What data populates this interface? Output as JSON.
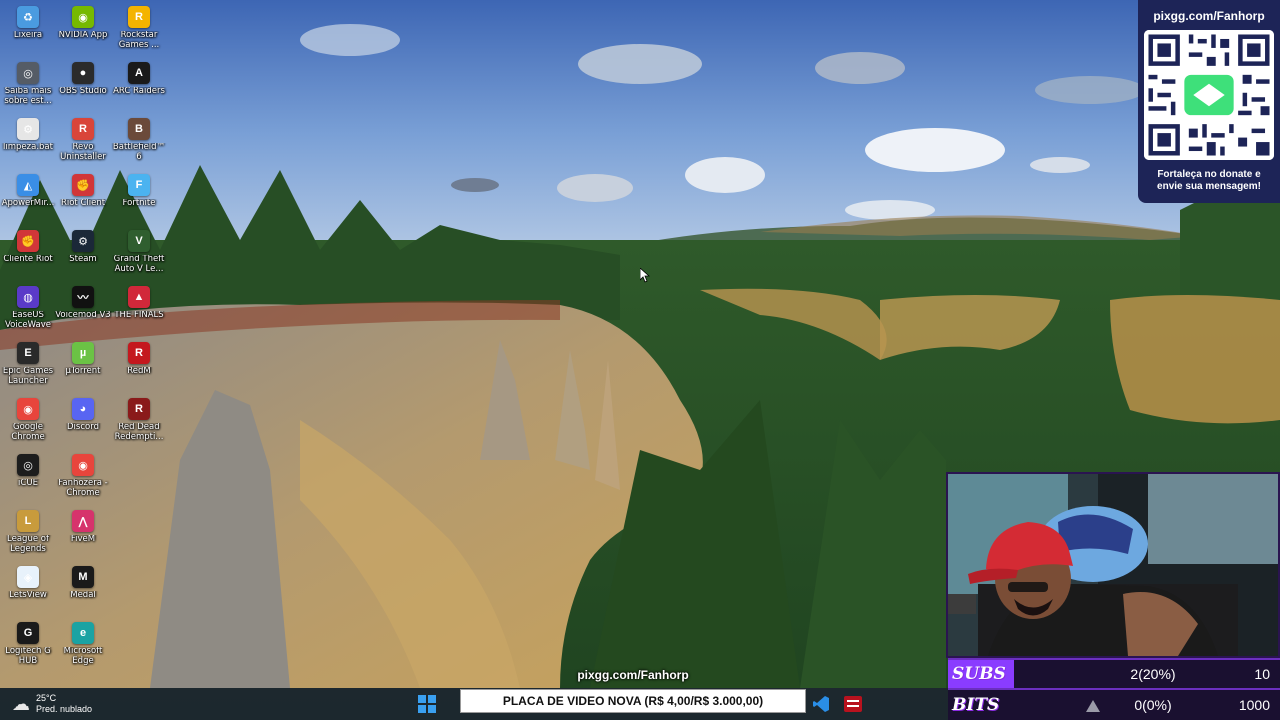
{
  "desktop_icons": [
    {
      "label": "Lixeira",
      "icon": "recycle-bin-icon",
      "color": "#4a9be0",
      "glyph": "♻"
    },
    {
      "label": "NVIDIA App",
      "icon": "nvidia-icon",
      "color": "#76b900",
      "glyph": "◉"
    },
    {
      "label": "Rockstar Games ...",
      "icon": "rockstar-icon",
      "color": "#f4b400",
      "glyph": "R"
    },
    {
      "label": "Saiba mais sobre est...",
      "icon": "info-camera-icon",
      "color": "#555c66",
      "glyph": "◎"
    },
    {
      "label": "OBS Studio",
      "icon": "obs-icon",
      "color": "#2b2b2b",
      "glyph": "●"
    },
    {
      "label": "ARC Raiders",
      "icon": "arc-raiders-icon",
      "color": "#1a1a1a",
      "glyph": "A"
    },
    {
      "label": "limpeza.bat",
      "icon": "bat-file-icon",
      "color": "#e6e6e6",
      "glyph": "⚙"
    },
    {
      "label": "Revo Uninstaller",
      "icon": "revo-icon",
      "color": "#d9453a",
      "glyph": "R"
    },
    {
      "label": "Battlefield™ 6",
      "icon": "battlefield-icon",
      "color": "#6b4a3a",
      "glyph": "B"
    },
    {
      "label": "ApowerMir...",
      "icon": "apowermirror-icon",
      "color": "#3a8ee6",
      "glyph": "◭"
    },
    {
      "label": "Riot Client",
      "icon": "riot-icon",
      "color": "#d13639",
      "glyph": "✊"
    },
    {
      "label": "Fortnite",
      "icon": "fortnite-icon",
      "color": "#4bb3f0",
      "glyph": "F"
    },
    {
      "label": "Cliente Riot",
      "icon": "riot-client-icon",
      "color": "#d13639",
      "glyph": "✊"
    },
    {
      "label": "Steam",
      "icon": "steam-icon",
      "color": "#1b2838",
      "glyph": "⚙"
    },
    {
      "label": "Grand Theft Auto V Le...",
      "icon": "gta-icon",
      "color": "#2f5e2f",
      "glyph": "V"
    },
    {
      "label": "EaseUS VoiceWave",
      "icon": "voicewave-icon",
      "color": "#5a3ac8",
      "glyph": "◍"
    },
    {
      "label": "Voicemod V3",
      "icon": "voicemod-icon",
      "color": "#111111",
      "glyph": "〰"
    },
    {
      "label": "THE FINALS",
      "icon": "the-finals-icon",
      "color": "#d1283a",
      "glyph": "▲"
    },
    {
      "label": "Epic Games Launcher",
      "icon": "epic-games-icon",
      "color": "#2a2a2a",
      "glyph": "E"
    },
    {
      "label": "µTorrent",
      "icon": "utorrent-icon",
      "color": "#6bc245",
      "glyph": "µ"
    },
    {
      "label": "RedM",
      "icon": "redm-icon",
      "color": "#c4181e",
      "glyph": "R"
    },
    {
      "label": "Google Chrome",
      "icon": "chrome-icon",
      "color": "#e8453c",
      "glyph": "◉"
    },
    {
      "label": "Discord",
      "icon": "discord-icon",
      "color": "#5865f2",
      "glyph": "◕"
    },
    {
      "label": "Red Dead Redempti...",
      "icon": "rdr-icon",
      "color": "#8a1a1a",
      "glyph": "R"
    },
    {
      "label": "iCUE",
      "icon": "icue-icon",
      "color": "#1d1d1d",
      "glyph": "◎"
    },
    {
      "label": "Fanhozera - Chrome",
      "icon": "chrome-profile-icon",
      "color": "#e8453c",
      "glyph": "◉"
    },
    {
      "label": "",
      "icon": "blank-icon",
      "color": "transparent",
      "glyph": ""
    },
    {
      "label": "League of Legends",
      "icon": "lol-icon",
      "color": "#c89b3c",
      "glyph": "L"
    },
    {
      "label": "FiveM",
      "icon": "fivem-icon",
      "color": "#d6336c",
      "glyph": "⋀"
    },
    {
      "label": "",
      "icon": "blank-icon",
      "color": "transparent",
      "glyph": ""
    },
    {
      "label": "LetsView",
      "icon": "letsview-icon",
      "color": "#e8f2fb",
      "glyph": "◈"
    },
    {
      "label": "Medal",
      "icon": "medal-icon",
      "color": "#1a1a1a",
      "glyph": "M"
    },
    {
      "label": "",
      "icon": "blank-icon",
      "color": "transparent",
      "glyph": ""
    },
    {
      "label": "Logitech G HUB",
      "icon": "logitech-icon",
      "color": "#1a1a1a",
      "glyph": "G"
    },
    {
      "label": "Microsoft Edge",
      "icon": "edge-icon",
      "color": "#1aa3a3",
      "glyph": "e"
    }
  ],
  "donate": {
    "url": "pixgg.com/Fanhorp",
    "message": "Fortaleça no donate e envie sua mensagem!",
    "accent": "#1d2457"
  },
  "goals": [
    {
      "name": "SUBS",
      "progress": "2(20%)",
      "target": "10",
      "fraction": 0.2,
      "fill_color": "#8a3cff"
    },
    {
      "name": "BITS",
      "progress": "0(0%)",
      "target": "1000",
      "fraction": 0.0,
      "fill_color": "#8a3cff"
    }
  ],
  "taskbar": {
    "weather_temp": "25°C",
    "weather_desc": "Pred. nublado"
  },
  "ticker": {
    "url": "pixgg.com/Fanhorp",
    "text": "PLACA DE VIDEO NOVA (R$ 4,00/R$ 3.000,00)"
  }
}
